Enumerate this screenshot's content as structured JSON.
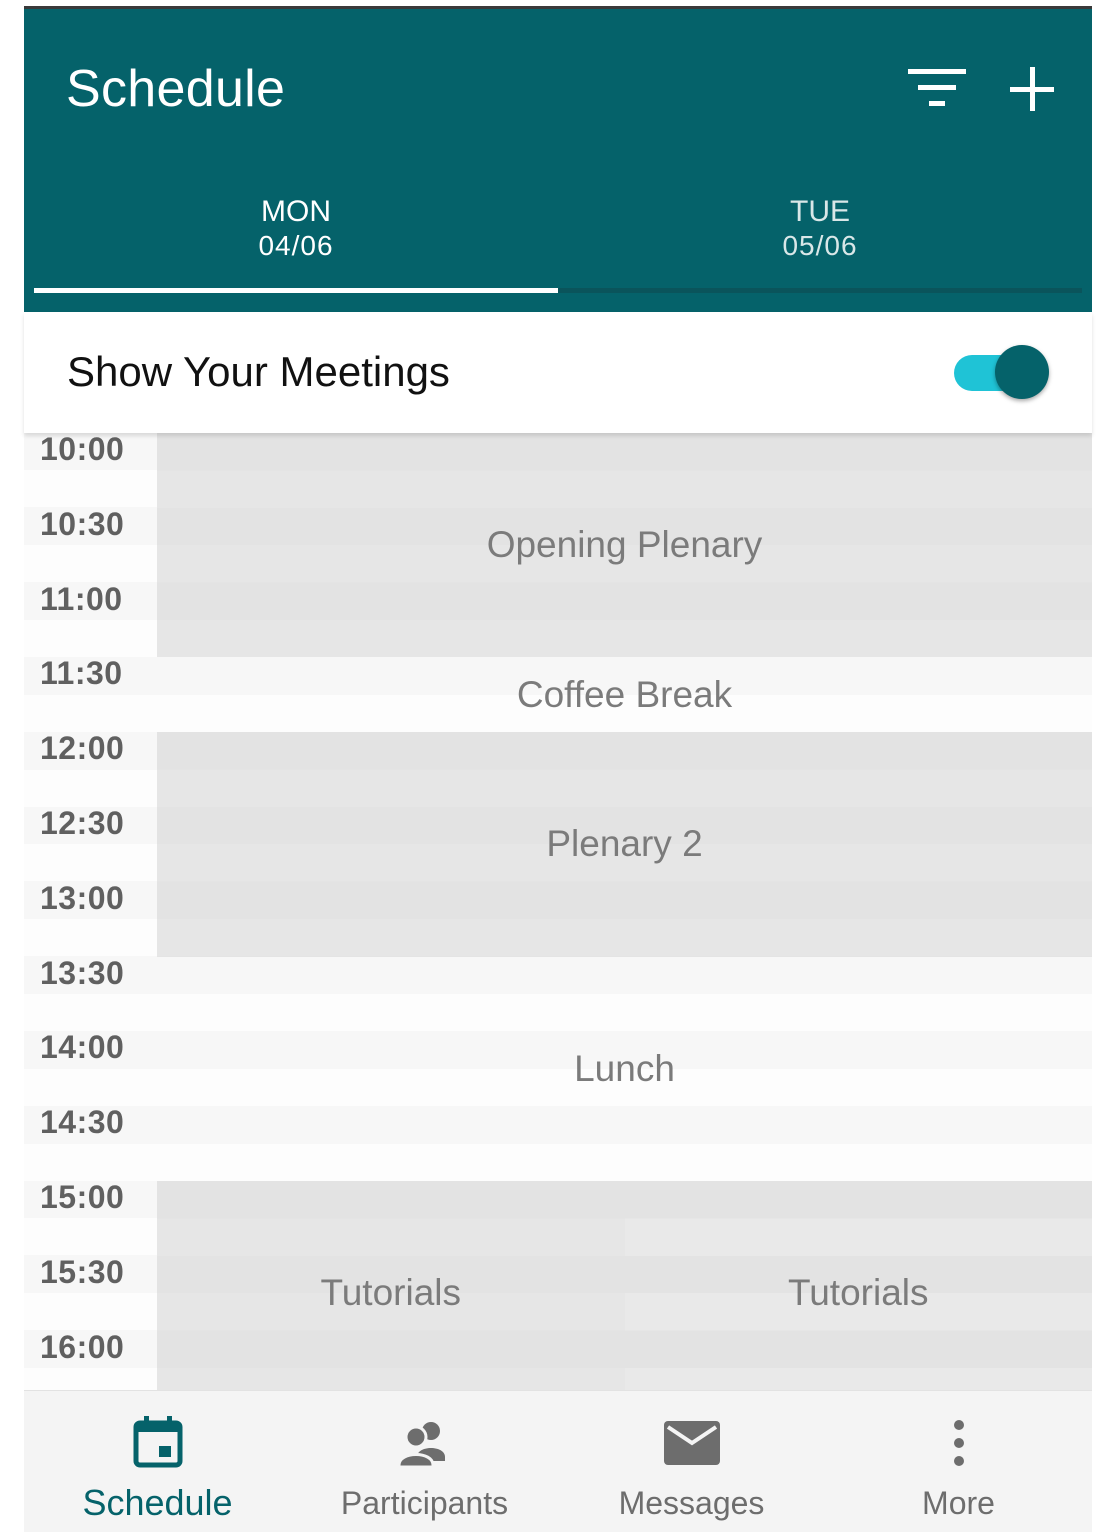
{
  "colors": {
    "primary": "#05626A",
    "accent": "#1FC3D6",
    "event_block": "#e3e3e3",
    "event_text": "#7b7b7b"
  },
  "header": {
    "title": "Schedule",
    "filter_icon": "filter-icon",
    "add_icon": "plus-icon"
  },
  "tabs": [
    {
      "day": "MON",
      "date": "04/06",
      "selected": true
    },
    {
      "day": "TUE",
      "date": "05/06",
      "selected": false
    }
  ],
  "toggle": {
    "label": "Show Your Meetings",
    "on": true
  },
  "times": [
    "10:00",
    "10:30",
    "11:00",
    "11:30",
    "12:00",
    "12:30",
    "13:00",
    "13:30",
    "14:00",
    "14:30",
    "15:00",
    "15:30",
    "16:00"
  ],
  "events": [
    {
      "title": "Opening Plenary",
      "start": "10:00",
      "end": "11:30",
      "column": "full",
      "shaded": true
    },
    {
      "title": "Coffee Break",
      "start": "11:30",
      "end": "12:00",
      "column": "full",
      "shaded": false
    },
    {
      "title": "Plenary 2",
      "start": "12:00",
      "end": "13:30",
      "column": "full",
      "shaded": true
    },
    {
      "title": "Lunch",
      "start": "13:30",
      "end": "15:00",
      "column": "full",
      "shaded": false
    },
    {
      "title": "Tutorials",
      "start": "15:00",
      "end": "16:30",
      "column": "left",
      "shaded": true
    },
    {
      "title": "Tutorials",
      "start": "15:00",
      "end": "16:30",
      "column": "right",
      "shaded": true
    }
  ],
  "nav": [
    {
      "label": "Schedule",
      "icon": "calendar-icon",
      "active": true
    },
    {
      "label": "Participants",
      "icon": "people-icon",
      "active": false
    },
    {
      "label": "Messages",
      "icon": "envelope-icon",
      "active": false
    },
    {
      "label": "More",
      "icon": "more-vertical-icon",
      "active": false
    }
  ]
}
